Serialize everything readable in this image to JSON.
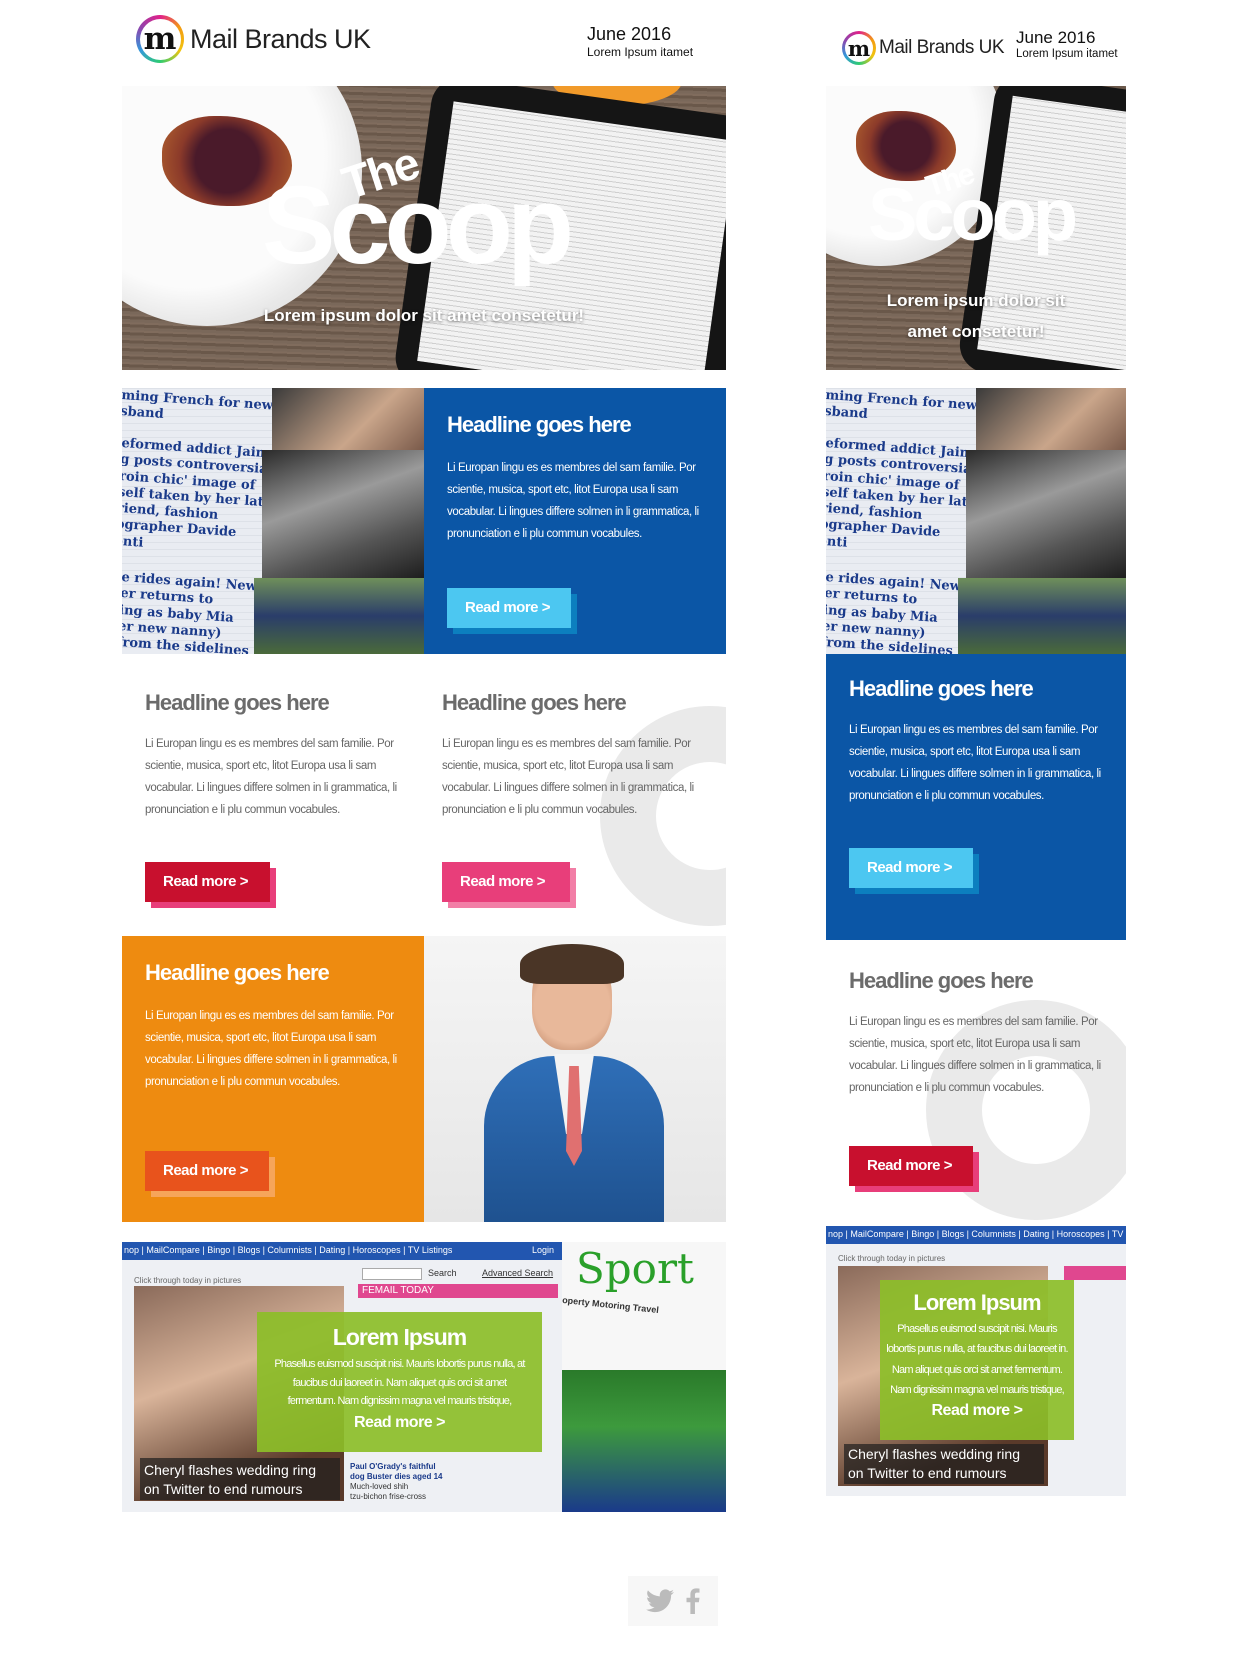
{
  "brand": {
    "name": "Mail Brands UK",
    "logo_letter": "m"
  },
  "issue": {
    "date": "June 2016",
    "tagline": "Lorem Ipsum itamet"
  },
  "hero": {
    "the": "The",
    "title": "Scoop",
    "subtitle_desktop": "Lorem ipsum dolor sit amet consetetur!",
    "subtitle_mobile_1": "Lorem ipsum dolor sit",
    "subtitle_mobile_2": "amet consetetur!"
  },
  "collage": {
    "snippet_1": "ming French for new\nsband",
    "snippet_2": "eformed addict Jaime\ng posts controversial\nroin chic' image of\nself taken by her late\nriend, fashion\nographer Davide\nenti",
    "snippet_3": "e rides again! New\ner returns to\ning as baby Mia\ner new nanny)\nfrom the sidelines"
  },
  "article_blue": {
    "headline": "Headline goes here",
    "body": "Li Europan lingu es es membres del sam familie. Por scientie, musica, sport etc, litot Europa usa li sam vocabular. Li lingues differe solmen in li grammatica, li pronunciation e li plu commun vocabules.",
    "cta": "Read more >"
  },
  "article_left": {
    "headline": "Headline goes here",
    "body": "Li Europan lingu es es membres del sam familie. Por scientie, musica, sport etc, litot Europa usa li sam vocabular. Li lingues differe solmen in li grammatica, li pronunciation e li plu commun vocabules.",
    "cta": "Read more >"
  },
  "article_right": {
    "headline": "Headline goes here",
    "body": "Li Europan lingu es es membres del sam familie. Por scientie, musica, sport etc, litot Europa usa li sam vocabular. Li lingues differe solmen in li grammatica, li pronunciation e li plu commun vocabules.",
    "cta": "Read more >"
  },
  "article_orange": {
    "headline": "Headline goes here",
    "body": "Li Europan lingu es es membres del sam familie. Por scientie, musica, sport etc, litot Europa usa li sam vocabular. Li lingues differe solmen in li grammatica, li pronunciation e li plu commun vocabules.",
    "cta": "Read more >"
  },
  "screenshot_site": {
    "nav": "nop | MailCompare | Bingo | Blogs | Columnists | Dating | Horoscopes | TV Listings",
    "nav_mobile": "nop | MailCompare | Bingo | Blogs | Columnists | Dating | Horoscopes | TV",
    "login": "Login",
    "search": "Search",
    "advanced": "Advanced Search",
    "click_through": "Click through today in pictures",
    "femail": "FEMAIL TODAY",
    "sport": "Sport",
    "sport_nav": "operty  Motoring  Travel",
    "caption_1": "Cheryl flashes wedding ring",
    "caption_2": "on Twitter to end rumours",
    "news_1": "Paul O'Grady's faithful",
    "news_2": "dog Buster dies aged 14",
    "news_3": "Much-loved shih",
    "news_4": "tzu-bichon frise-cross"
  },
  "promo": {
    "title": "Lorem Ipsum",
    "body": "Phasellus euismod suscipit nisi. Mauris lobortis purus nulla, at faucibus dui laoreet in. Nam aliquet quis orci sit amet fermentum. Nam dignissim magna vel mauris tristique,",
    "cta": "Read more >"
  },
  "social": {
    "twitter": "twitter-icon",
    "facebook": "facebook-icon"
  },
  "colors": {
    "blue": "#0b56a6",
    "cyan": "#4cc7f1",
    "crimson": "#c8102e",
    "pink": "#e83e7a",
    "orange": "#ee8b10",
    "orange_btn": "#e8531c",
    "green": "#8cbe28",
    "headline_grey": "#6b6b6b"
  }
}
